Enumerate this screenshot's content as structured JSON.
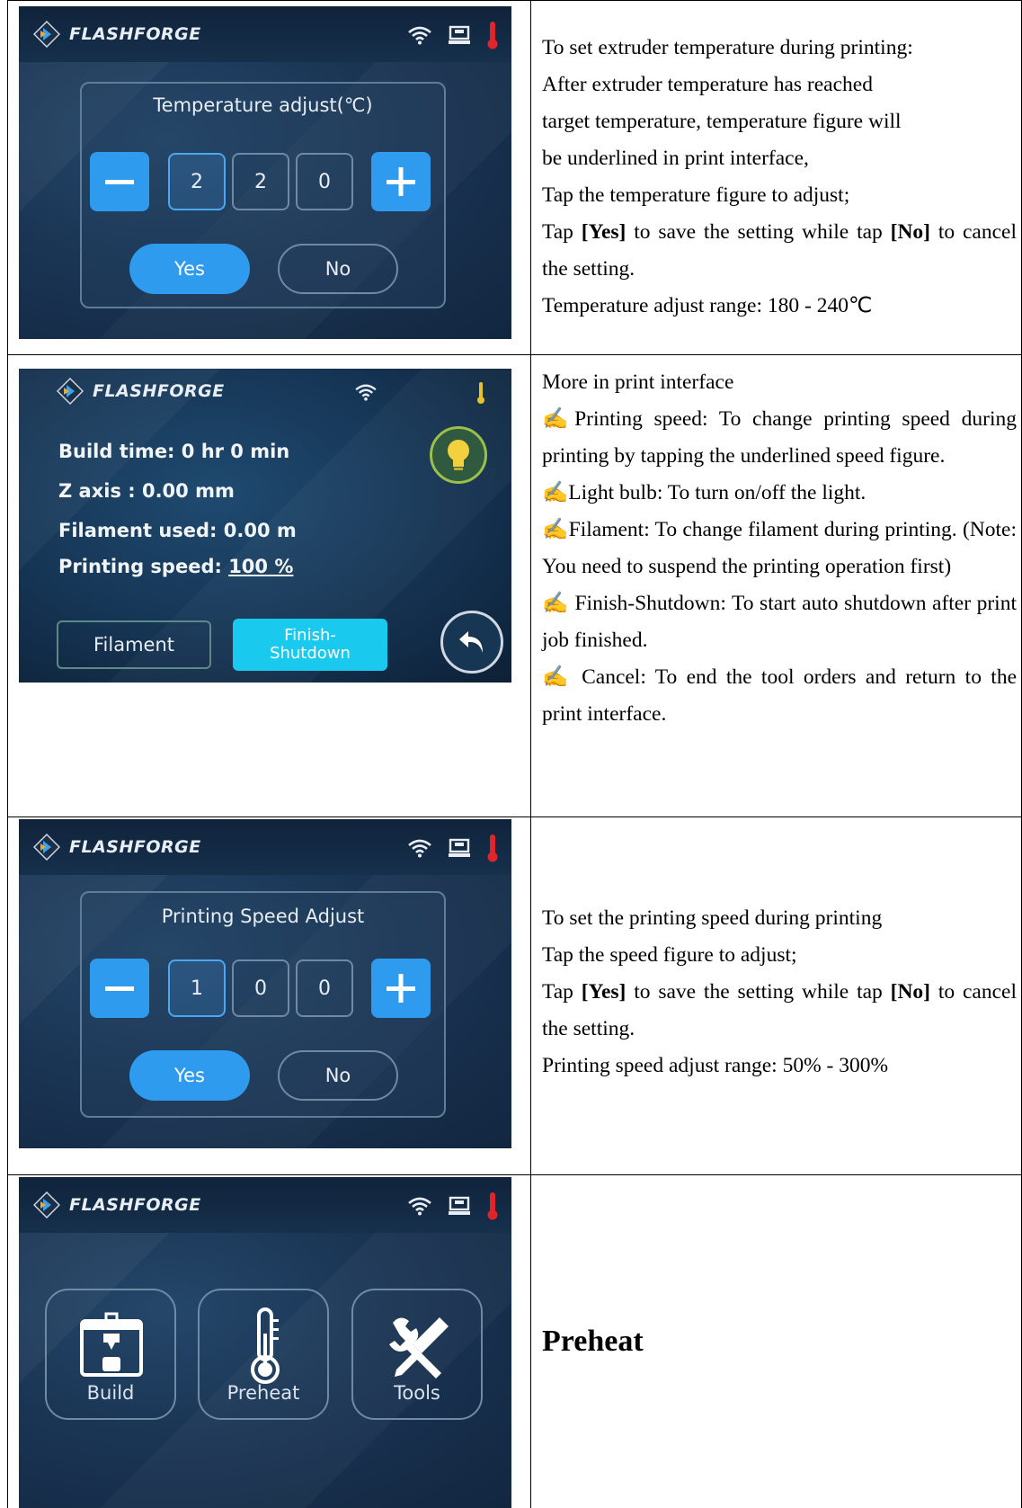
{
  "brand": "FLASHFORGE",
  "row1": {
    "screen": {
      "title": "Temperature adjust(℃)",
      "digits": [
        "2",
        "2",
        "0"
      ],
      "yes": "Yes",
      "no": "No"
    },
    "text": [
      "To set extruder temperature during printing:",
      "After extruder temperature has reached",
      "target temperature, temperature figure will",
      "be underlined in print interface,",
      "Tap the temperature figure to adjust;"
    ],
    "yes_line": {
      "pre": "Tap ",
      "yes": "[Yes]",
      "mid": " to save the setting while tap ",
      "no": "[No]",
      "post": " to cancel the setting."
    },
    "range": "Temperature adjust range: 180 - 240℃"
  },
  "row2": {
    "screen": {
      "build_time": "Build time: 0 hr 0 min",
      "z_axis": "Z axis : 0.00 mm",
      "filament_used": "Filament used: 0.00 m",
      "speed_label": "Printing speed: ",
      "speed_value": "100 %",
      "filament_btn": "Filament",
      "finish_btn_1": "Finish-",
      "finish_btn_2": "Shutdown"
    },
    "text_title": "More in print interface",
    "items": [
      "✍Printing speed: To change printing speed during printing by tapping the underlined speed figure.",
      "✍Light bulb: To turn on/off the light.",
      "✍Filament: To change filament during printing. (Note: You need to suspend the printing operation first)",
      "✍ Finish-Shutdown: To start auto shutdown after print job finished.",
      "✍ Cancel: To end the tool orders and return to the print interface."
    ]
  },
  "row3": {
    "screen": {
      "title": "Printing Speed Adjust",
      "digits": [
        "1",
        "0",
        "0"
      ],
      "yes": "Yes",
      "no": "No"
    },
    "text": [
      "To set the printing speed during printing",
      "Tap the speed figure to adjust;"
    ],
    "yes_line": {
      "pre": "Tap ",
      "yes": "[Yes]",
      "mid": " to save the setting while tap ",
      "no": "[No]",
      "post": " to cancel the setting."
    },
    "range": "Printing speed adjust range: 50% - 300%"
  },
  "row4": {
    "screen": {
      "build": "Build",
      "preheat": "Preheat",
      "tools": "Tools"
    },
    "heading": "Preheat"
  },
  "colors": {
    "accent": "#2f9bee",
    "screen_bg": "#1a3554",
    "thermo_red": "#e0242a"
  }
}
